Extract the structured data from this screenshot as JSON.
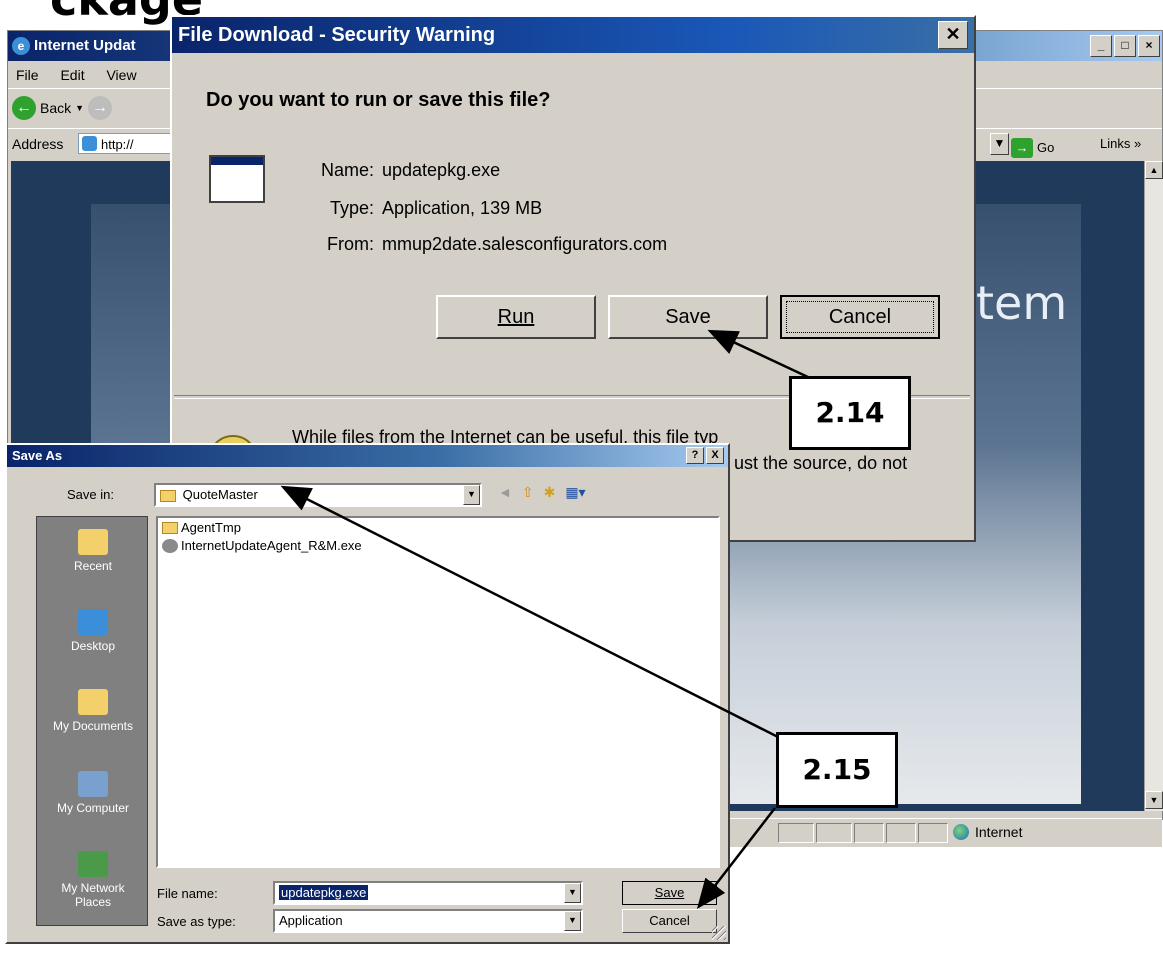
{
  "page_title_fragment": "ckage",
  "ie": {
    "title": "Internet Updat",
    "menu": [
      "File",
      "Edit",
      "View"
    ],
    "back_label": "Back",
    "address_label": "Address",
    "address_value": "http://",
    "go_label": "Go",
    "links_label": "Links",
    "banner_text": "tem",
    "status_zone": "Internet"
  },
  "security_dialog": {
    "title": "File Download - Security Warning",
    "question": "Do you want to run or save this file?",
    "name_label": "Name:",
    "name_value": "updatepkg.exe",
    "type_label": "Type:",
    "type_value": "Application, 139 MB",
    "from_label": "From:",
    "from_value": "mmup2date.salesconfigurators.com",
    "run_label": "Run",
    "save_label": "Save",
    "cancel_label": "Cancel",
    "warning_line1": "While files from the Internet can be useful, this file typ",
    "warning_line2": "ust the source, do not"
  },
  "save_as": {
    "title": "Save As",
    "help_btn": "?",
    "close_btn": "X",
    "save_in_label": "Save in:",
    "save_in_value": "QuoteMaster",
    "places": [
      "Recent",
      "Desktop",
      "My Documents",
      "My Computer",
      "My Network Places"
    ],
    "files": [
      "AgentTmp",
      "InternetUpdateAgent_R&M.exe"
    ],
    "file_name_label": "File name:",
    "file_name_value": "updatepkg.exe",
    "save_as_type_label": "Save as type:",
    "save_as_type_value": "Application",
    "save_button": "Save",
    "cancel_button": "Cancel"
  },
  "callouts": {
    "step_a": "2.14",
    "step_b": "2.15"
  },
  "colors": {
    "titlebar": "#0a246a",
    "dialog_face": "#d4d0c8",
    "ie_content_bg": "#1f3a5a"
  }
}
